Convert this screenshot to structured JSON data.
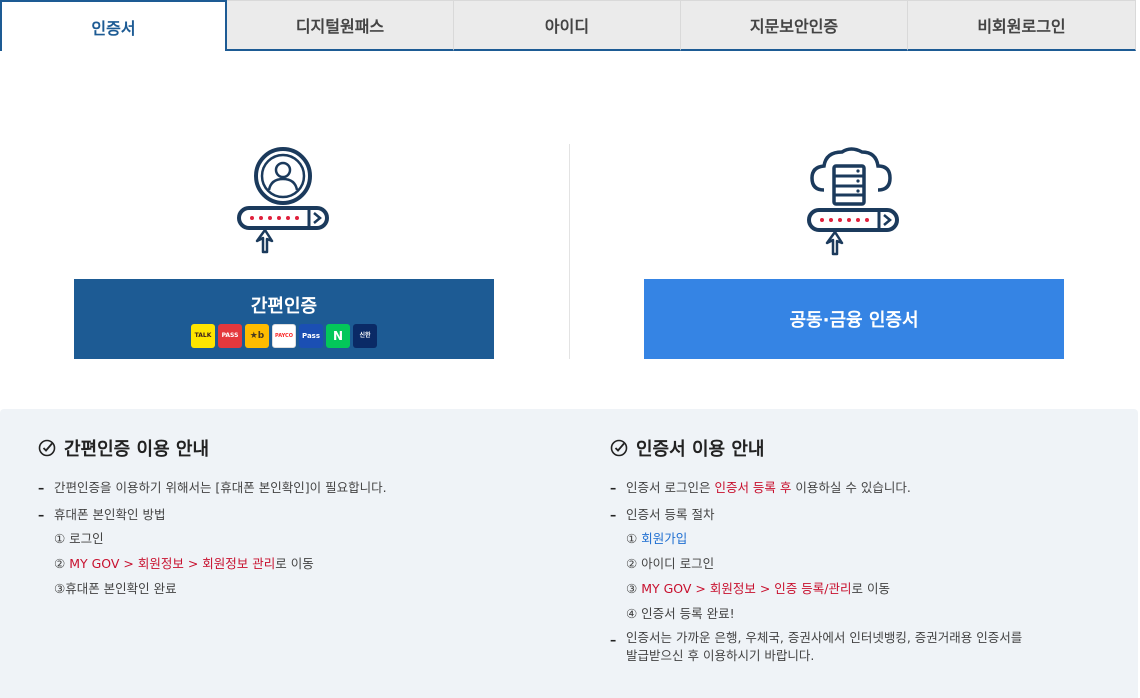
{
  "tabs": [
    {
      "label": "인증서",
      "active": true
    },
    {
      "label": "디지털원패스",
      "active": false
    },
    {
      "label": "아이디",
      "active": false
    },
    {
      "label": "지문보안인증",
      "active": false
    },
    {
      "label": "비회원로그인",
      "active": false
    }
  ],
  "simple_auth": {
    "button_label": "간편인증",
    "providers": [
      {
        "name": "kakao-talk",
        "label": "TALK",
        "bg": "#fee500",
        "fg": "#3c1e1e"
      },
      {
        "name": "pass",
        "label": "PASS",
        "bg": "#e4383d",
        "fg": "#ffffff"
      },
      {
        "name": "kb",
        "label": "★b",
        "bg": "#ffbc00",
        "fg": "#4a3a20"
      },
      {
        "name": "payco",
        "label": "PAYCO",
        "bg": "#fa2828",
        "fg": "#ffffff"
      },
      {
        "name": "samsung-pass",
        "label": "Pass",
        "bg": "#1b4fb3",
        "fg": "#ffffff"
      },
      {
        "name": "naver",
        "label": "N",
        "bg": "#03c75a",
        "fg": "#ffffff"
      },
      {
        "name": "shinhan",
        "label": "신한",
        "bg": "#0a2a66",
        "fg": "#ffffff"
      }
    ]
  },
  "cert_auth": {
    "button_label": "공동·금융 인증서"
  },
  "colors": {
    "primary_dark": "#1d5b94",
    "primary_light": "#3584e4",
    "accent_red": "#c8102e",
    "link_blue": "#1f6fd1"
  },
  "info_left": {
    "title": "간편인증 이용 안내",
    "line1": "간편인증을 이용하기 위해서는 [휴대폰 본인확인]이 필요합니다.",
    "line2": "휴대폰 본인확인 방법",
    "steps": {
      "s1": "① 로그인",
      "s2_prefix": "② ",
      "s2_red": "MY GOV > 회원정보 > 회원정보 관리",
      "s2_suffix": "로 이동",
      "s3": "③휴대폰 본인확인 완료"
    }
  },
  "info_right": {
    "title": "인증서 이용 안내",
    "line1_prefix": "인증서 로그인은 ",
    "line1_red": "인증서 등록 후",
    "line1_suffix": " 이용하실 수 있습니다.",
    "line2": "인증서 등록 절차",
    "steps": {
      "s1_prefix": "① ",
      "s1_link": "회원가입",
      "s2": "② 아이디 로그인",
      "s3_prefix": "③ ",
      "s3_red": "MY GOV > 회원정보 > 인증 등록/관리",
      "s3_suffix": "로 이동",
      "s4": "④ 인증서 등록 완료!"
    },
    "line3a": "인증서는 가까운 은행, 우체국, 증권사에서 인터넷뱅킹, 증권거래용 인증서를",
    "line3b": "발급받으신 후 이용하시기 바랍니다."
  }
}
